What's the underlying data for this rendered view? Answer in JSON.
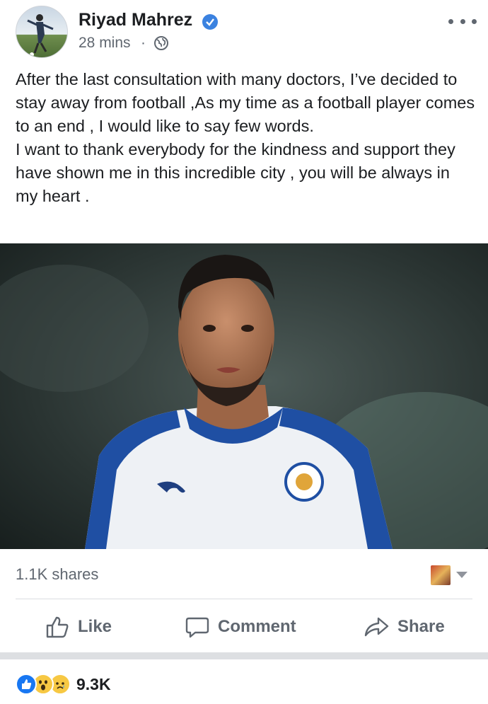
{
  "post": {
    "author": "Riyad Mahrez",
    "time": "28 mins",
    "separator": "·",
    "audience_icon": "globe-icon",
    "verified_icon": "verified-badge-icon",
    "text": "After the last consultation with many doctors, I’ve decided to stay away from football ,As my time as a football player comes to an end , I would like to say few words.\nI want to thank everybody for the kindness and support they have shown me in this incredible city , you will be always in my heart ."
  },
  "stats": {
    "shares": "1.1K shares",
    "reactions_count": "9.3K",
    "reaction_icons": [
      "like-reaction-icon",
      "wow-reaction-icon",
      "sad-reaction-icon"
    ]
  },
  "actions": {
    "like": "Like",
    "comment": "Comment",
    "share": "Share"
  },
  "colors": {
    "text": "#1c1e21",
    "secondary_text": "#606770",
    "verified_blue": "#3b82e0",
    "like_blue": "#1877f2",
    "reaction_yellow": "#f7c843",
    "divider": "#dadde1",
    "separator_band": "#dddfe2"
  }
}
